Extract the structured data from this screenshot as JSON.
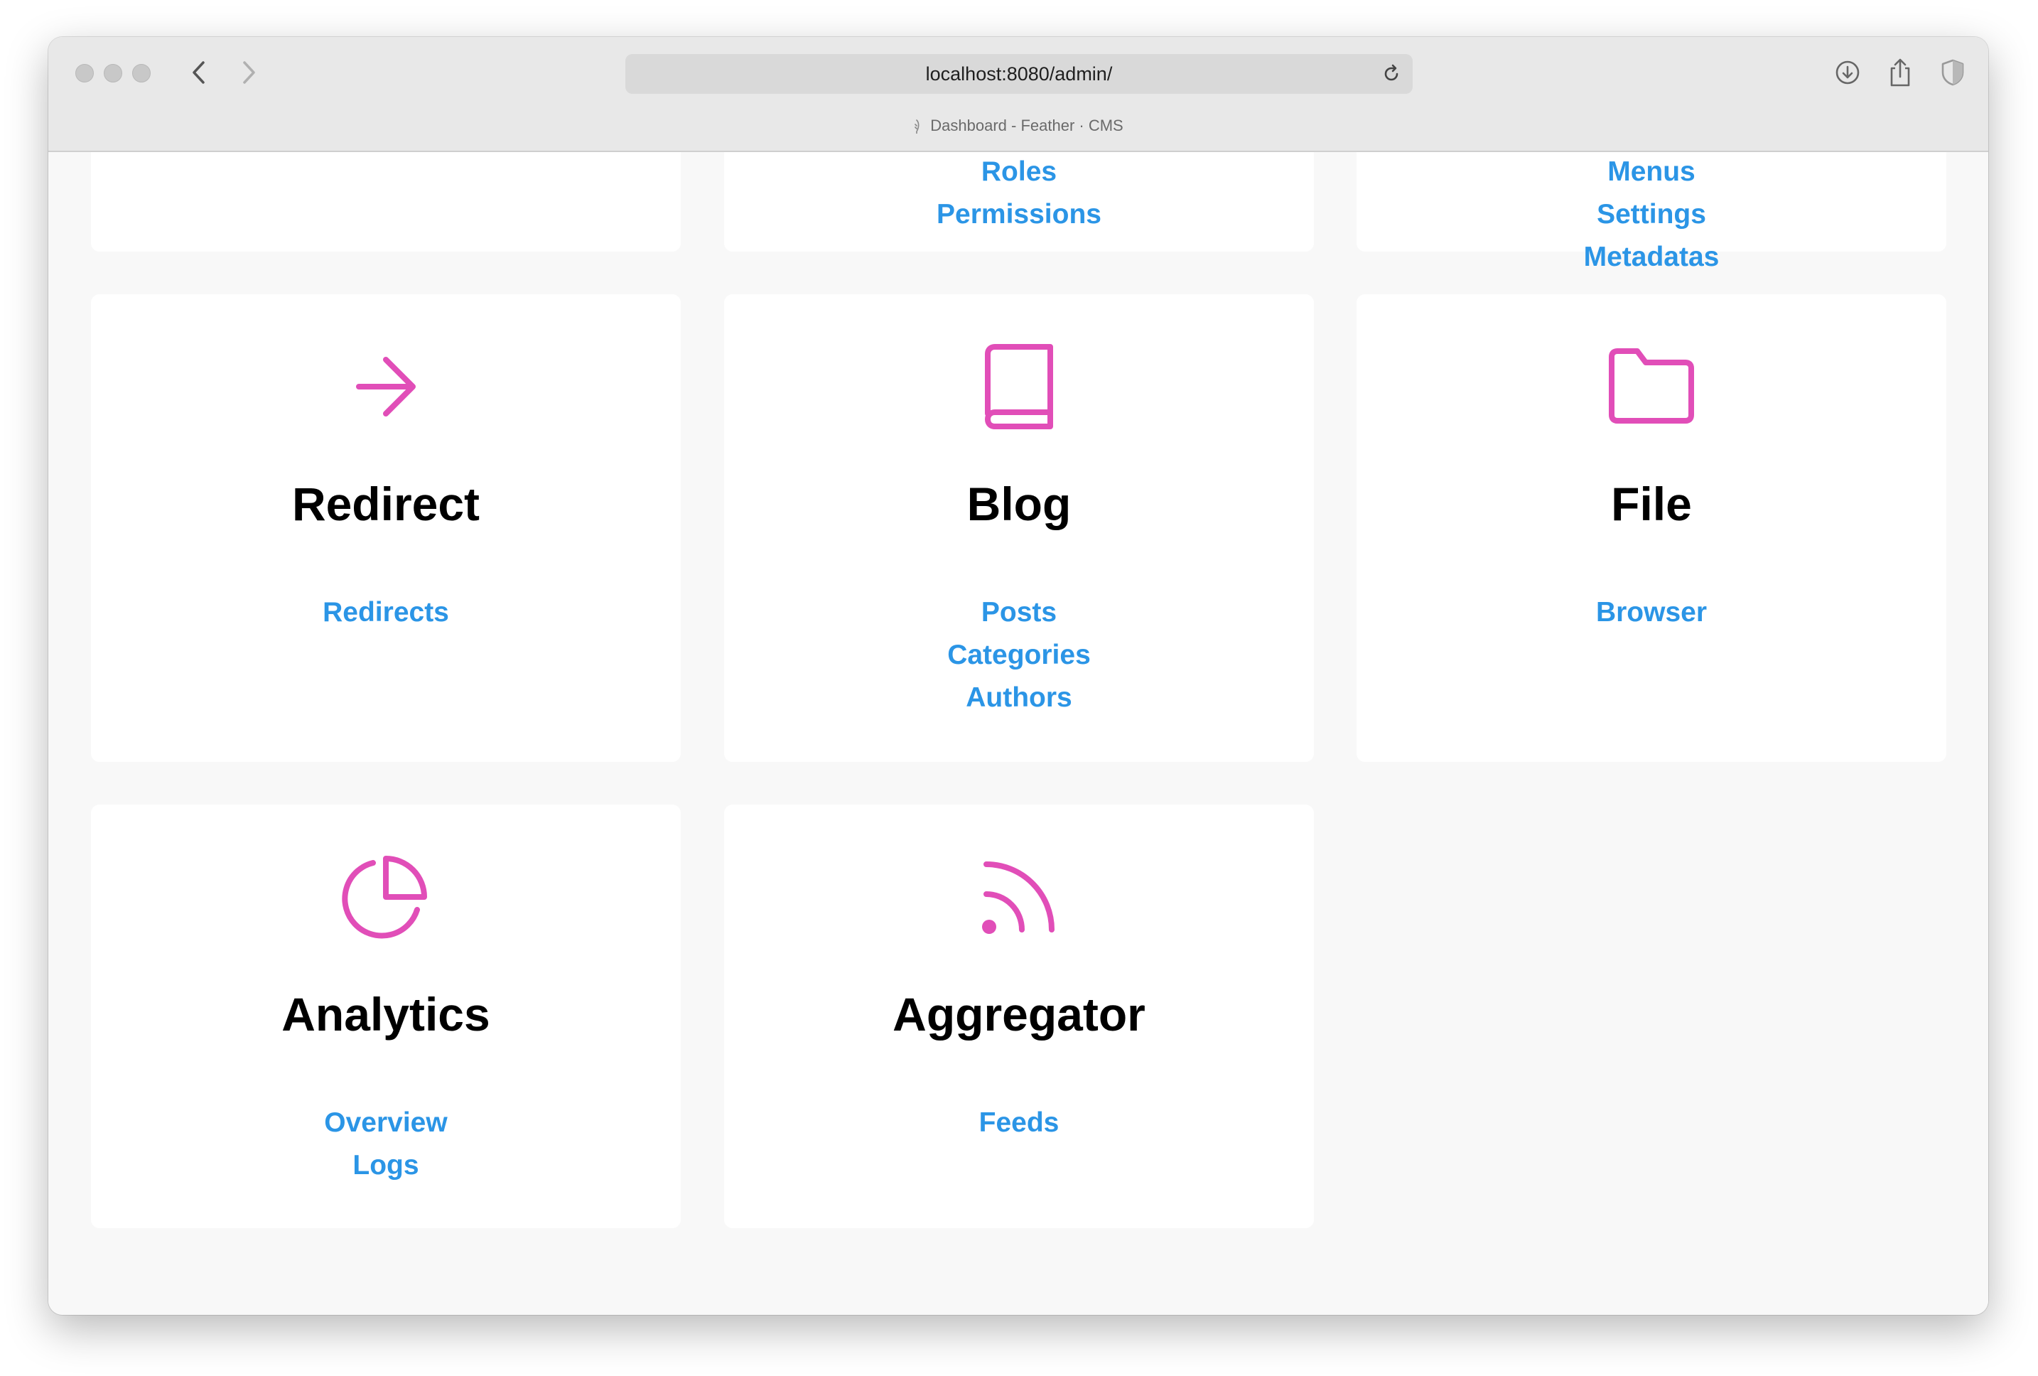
{
  "browser": {
    "url": "localhost:8080/admin/",
    "tab_title": "Dashboard - Feather · CMS"
  },
  "colors": {
    "accent_icon": "#e14eb8",
    "link": "#2b95e6"
  },
  "top_partial": {
    "col2_links": [
      "Roles",
      "Permissions"
    ],
    "col3_links": [
      "Menus",
      "Settings",
      "Metadatas"
    ]
  },
  "modules": [
    {
      "title": "Redirect",
      "icon": "arrow-right-icon",
      "links": [
        "Redirects"
      ]
    },
    {
      "title": "Blog",
      "icon": "book-icon",
      "links": [
        "Posts",
        "Categories",
        "Authors"
      ]
    },
    {
      "title": "File",
      "icon": "folder-icon",
      "links": [
        "Browser"
      ]
    },
    {
      "title": "Analytics",
      "icon": "pie-chart-icon",
      "links": [
        "Overview",
        "Logs"
      ]
    },
    {
      "title": "Aggregator",
      "icon": "rss-icon",
      "links": [
        "Feeds"
      ]
    }
  ]
}
